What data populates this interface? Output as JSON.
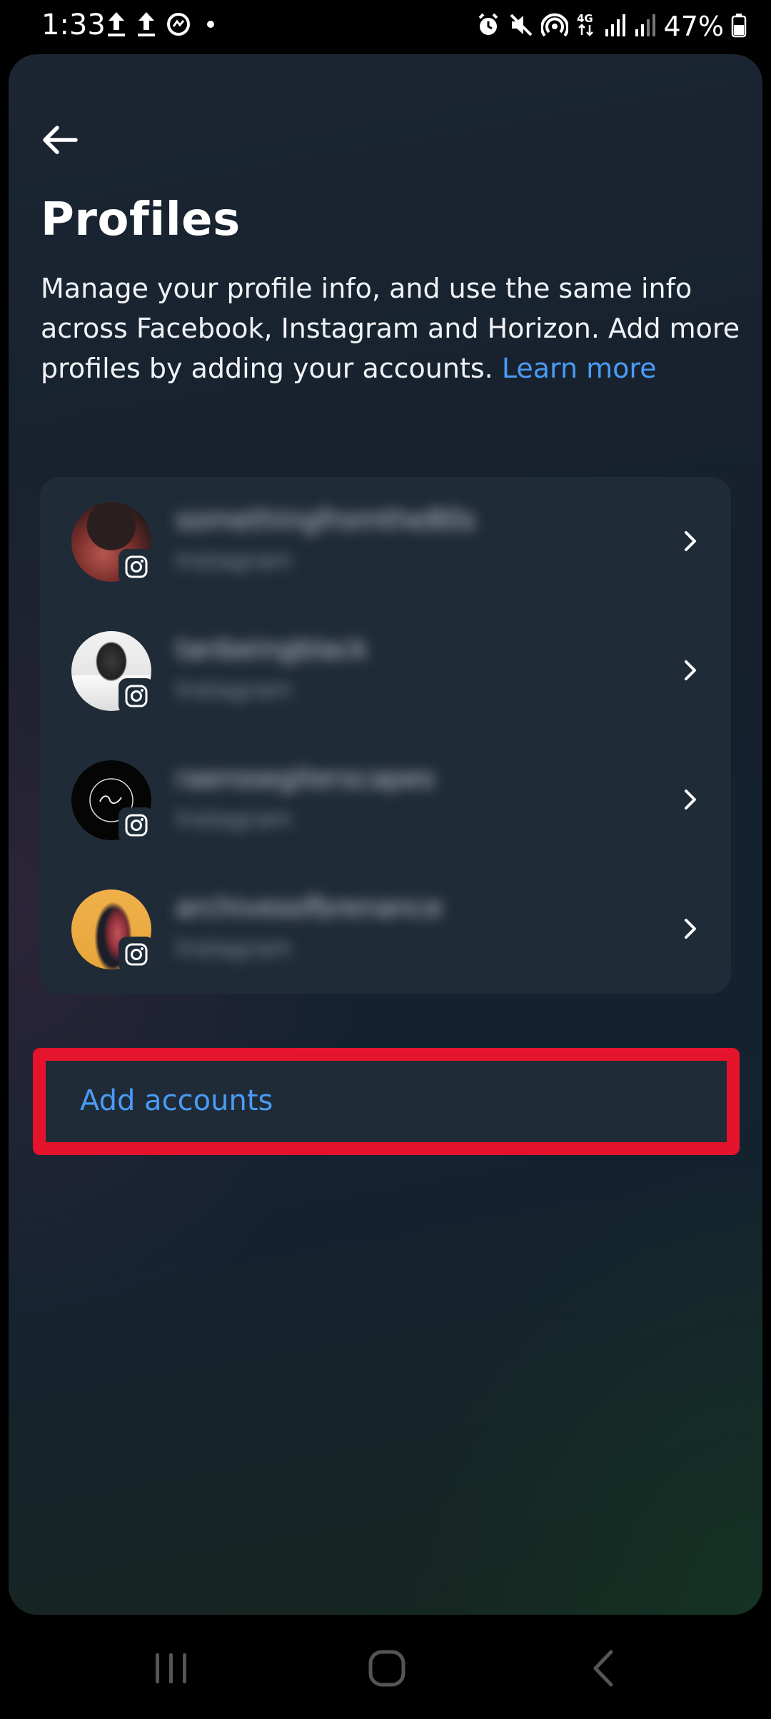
{
  "status_bar": {
    "time": "1:33",
    "battery": "47%",
    "left_icons": [
      "upload-icon",
      "upload-icon",
      "messenger-icon",
      "dot-icon"
    ],
    "right_icons": [
      "alarm-icon",
      "mute-icon",
      "hotspot-icon",
      "4g-icon",
      "signal-icon",
      "signal-icon",
      "battery-icon"
    ]
  },
  "header": {
    "title": "Profiles",
    "description": "Manage your profile info, and use the same info across Facebook, Instagram and Horizon. Add more profiles by adding your accounts. ",
    "learn_more": "Learn more"
  },
  "profiles": [
    {
      "name": "somethingfromthe80s",
      "platform": "Instagram"
    },
    {
      "name": "tanbeingblack",
      "platform": "Instagram"
    },
    {
      "name": "raerosegiterscapes",
      "platform": "Instagram"
    },
    {
      "name": "archivesofbrenance",
      "platform": "Instagram"
    }
  ],
  "add_accounts_label": "Add accounts",
  "colors": {
    "accent_link": "#4a9bf5",
    "highlight_border": "#e5132c",
    "card_bg": "#1f2b37"
  }
}
